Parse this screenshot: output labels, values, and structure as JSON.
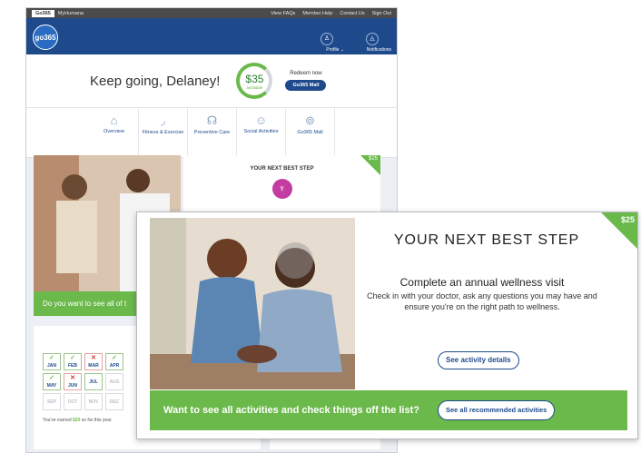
{
  "bg": {
    "tabs": [
      "Go365",
      "MyHumana"
    ],
    "util_links": [
      "View FAQs",
      "Member Help",
      "Contact Us",
      "Sign Out"
    ],
    "logo_text": "go365",
    "profile_label": "Profile ⌄",
    "notifications_label": "Notifications",
    "greeting": "Keep going, Delaney!",
    "amount": "$35",
    "available": "available",
    "redeem_label": "Redeem now",
    "mall_button": "Go365 Mall",
    "nav": [
      {
        "label": "Overview",
        "icon": "home-icon"
      },
      {
        "label": "Fitness & Exercise",
        "icon": "shoe-icon"
      },
      {
        "label": "Preventive Care",
        "icon": "stethoscope-icon"
      },
      {
        "label": "Social Activities",
        "icon": "people-icon"
      },
      {
        "label": "Go365 Mall",
        "icon": "bag-icon"
      }
    ],
    "next_step_title": "YOUR NEXT BEST STEP",
    "next_step_reward": "$25",
    "see_all_text": "Do you want to see all of t",
    "activity_title": "YOUR A",
    "months": [
      {
        "m": "JAN",
        "s": "✓"
      },
      {
        "m": "FEB",
        "s": "✓"
      },
      {
        "m": "MAR",
        "s": "✕"
      },
      {
        "m": "APR",
        "s": "✓"
      },
      {
        "m": "MAY",
        "s": "✓"
      },
      {
        "m": "JUN",
        "s": "✕"
      },
      {
        "m": "JUL",
        "s": ""
      },
      {
        "m": "AUG",
        "s": ""
      },
      {
        "m": "SEP",
        "s": ""
      },
      {
        "m": "OCT",
        "s": ""
      },
      {
        "m": "NOV",
        "s": ""
      },
      {
        "m": "DEC",
        "s": ""
      }
    ],
    "earned_prefix": "You've earned ",
    "earned_amount": "$20",
    "earned_suffix": " so far this year."
  },
  "card": {
    "title": "YOUR NEXT BEST STEP",
    "reward": "$25",
    "main_text": "Complete an annual wellness visit",
    "description": "Check in with your doctor, ask any questions you may have and ensure you're on the right path to wellness.",
    "details_button": "See activity details",
    "banner_text": "Want to see all activities and check things off the list?",
    "banner_button": "See all recommended activities"
  },
  "colors": {
    "brand": "#1e4a8c",
    "accent": "#6ab94a",
    "alert": "#dd3333"
  }
}
